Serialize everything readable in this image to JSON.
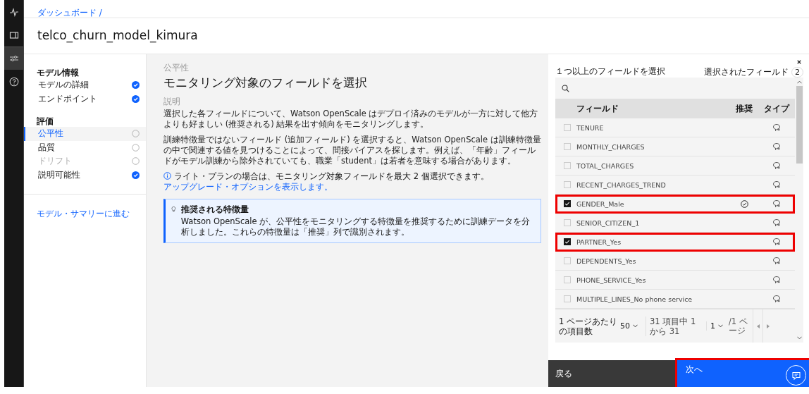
{
  "breadcrumb": "ダッシュボード /",
  "title": "telco_churn_model_kimura",
  "rail": [
    {
      "selected": false
    },
    {
      "selected": false
    },
    {
      "selected": true
    },
    {
      "selected": false
    }
  ],
  "nav": [
    {
      "kind": "heading",
      "label": "モデル情報"
    },
    {
      "kind": "item",
      "label": "モデルの詳細",
      "done": true,
      "selected": false,
      "disabled": false
    },
    {
      "kind": "item",
      "label": "エンドポイント",
      "done": true,
      "selected": false,
      "disabled": false
    },
    {
      "kind": "heading",
      "label": "評価"
    },
    {
      "kind": "item",
      "label": "公平性",
      "done": false,
      "selected": true,
      "disabled": false
    },
    {
      "kind": "item",
      "label": "品質",
      "done": false,
      "selected": false,
      "disabled": false
    },
    {
      "kind": "item",
      "label": "ドリフト",
      "done": false,
      "selected": false,
      "disabled": true
    },
    {
      "kind": "item",
      "label": "説明可能性",
      "done": true,
      "selected": false,
      "disabled": false
    }
  ],
  "summary_link": "モデル・サマリーに進む",
  "main": {
    "eyebrow": "公平性",
    "heading": "モニタリング対象のフィールドを選択",
    "desc_label": "説明",
    "paragraphs": [
      "選択した各フィールドについて、Watson OpenScale はデプロイ済みのモデルが一方に対して他方よりも好ましい (推奨される) 結果を出す傾向をモニタリングします。",
      "訓練特徴量ではないフィールド (追加フィールド) を選択すると、Watson OpenScale は訓練特徴量の中で関連する値を見つけることによって、間接バイアスを探します。例えば、「年齢」フィールドがモデル訓練から除外されていても、職業「student」は若者を意味する場合があります。"
    ],
    "info": "ライト・プランの場合は、モニタリング対象フィールドを最大 2 個選択できます。",
    "info_link": "アップグレード・オプションを表示します。",
    "callout_title": "推奨される特徴量",
    "callout_text": "Watson OpenScale が、公平性をモニタリングする特徴量を推奨するために訓練データを分析しました。これらの特徴量は「推奨」列で識別されます。"
  },
  "panel": {
    "prompt": "１つ以上のフィールドを選択",
    "selected_label": "選択されたフィールド",
    "selected_count": "2",
    "columns": [
      "フィールド",
      "推奨",
      "タイプ"
    ],
    "rows": [
      {
        "name": "TENURE",
        "checked": false,
        "recommended": false,
        "highlighted": false
      },
      {
        "name": "MONTHLY_CHARGES",
        "checked": false,
        "recommended": false,
        "highlighted": false
      },
      {
        "name": "TOTAL_CHARGES",
        "checked": false,
        "recommended": false,
        "highlighted": false
      },
      {
        "name": "RECENT_CHARGES_TREND",
        "checked": false,
        "recommended": false,
        "highlighted": false
      },
      {
        "name": "GENDER_Male",
        "checked": true,
        "recommended": true,
        "highlighted": true
      },
      {
        "name": "SENIOR_CITIZEN_1",
        "checked": false,
        "recommended": false,
        "highlighted": false
      },
      {
        "name": "PARTNER_Yes",
        "checked": true,
        "recommended": false,
        "highlighted": true
      },
      {
        "name": "DEPENDENTS_Yes",
        "checked": false,
        "recommended": false,
        "highlighted": false
      },
      {
        "name": "PHONE_SERVICE_Yes",
        "checked": false,
        "recommended": false,
        "highlighted": false
      },
      {
        "name": "MULTIPLE_LINES_No phone service",
        "checked": false,
        "recommended": false,
        "highlighted": false
      }
    ],
    "per_page_label": "1 ページあたりの項目数",
    "per_page": "50",
    "range": "31 項目中 1 から 31",
    "page": "1",
    "page_of": "/1 ページ",
    "back": "戻る",
    "next": "次へ",
    "next_highlighted": true
  }
}
